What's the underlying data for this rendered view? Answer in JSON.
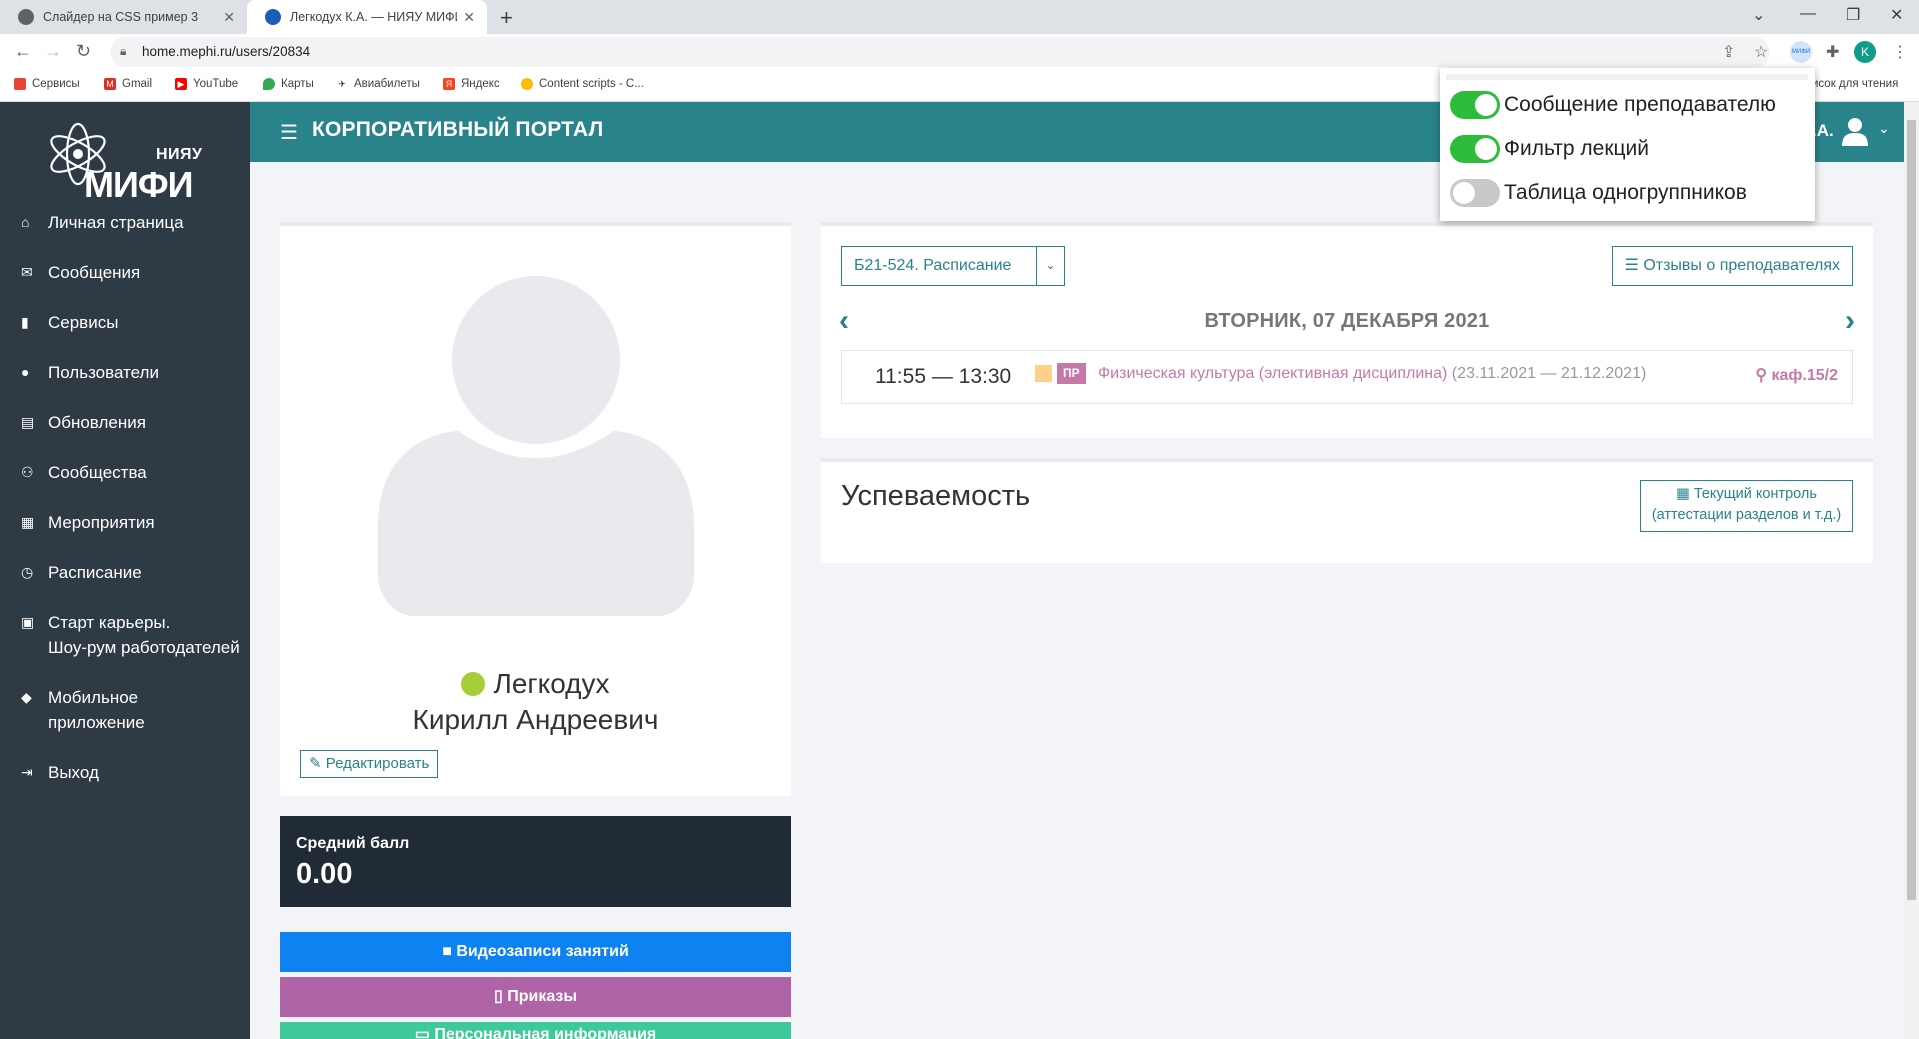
{
  "browser": {
    "tabs": [
      {
        "title": "Слайдер на CSS пример 3",
        "active": false
      },
      {
        "title": "Легкодух К.А. — НИЯУ МИФИ",
        "active": true
      }
    ],
    "url": "home.mephi.ru/users/20834",
    "bookmarks": [
      "Сервисы",
      "Gmail",
      "YouTube",
      "Карты",
      "Авиабилеты",
      "Яндекс",
      "Content scripts - C..."
    ],
    "reading_list": "исок для чтения",
    "profile_initial": "K"
  },
  "sidebar": {
    "logo": {
      "top": "НИЯУ",
      "main": "МИФИ"
    },
    "items": [
      {
        "icon": "home-icon",
        "label": "Личная страница"
      },
      {
        "icon": "envelope-icon",
        "label": "Сообщения"
      },
      {
        "icon": "bookmark-icon",
        "label": "Сервисы"
      },
      {
        "icon": "user-icon",
        "label": "Пользователи"
      },
      {
        "icon": "newspaper-icon",
        "label": "Обновления"
      },
      {
        "icon": "users-icon",
        "label": "Сообщества"
      },
      {
        "icon": "calendar-icon",
        "label": "Мероприятия"
      },
      {
        "icon": "clock-icon",
        "label": "Расписание"
      },
      {
        "icon": "briefcase-icon",
        "label": "Старт карьеры.\nШоу-рум работодателей"
      },
      {
        "icon": "android-icon",
        "label": "Мобильное\nприложение"
      },
      {
        "icon": "sign-out-icon",
        "label": "Выход"
      }
    ]
  },
  "header": {
    "title": "КОРПОРАТИВНЫЙ ПОРТАЛ",
    "user_short": ".А."
  },
  "profile": {
    "name_line1": "Легкодух",
    "name_line2": "Кирилл Андреевич",
    "edit_label": "Редактировать",
    "status_color": "#a6ce39"
  },
  "gpa": {
    "label": "Средний балл",
    "value": "0.00"
  },
  "buttons": {
    "video": "Видеозаписи занятий",
    "orders": "Приказы",
    "personal": "Персональная информация"
  },
  "schedule": {
    "group": "Б21-524. Расписание",
    "reviews": "Отзывы о преподавателях",
    "day": "ВТОРНИК, 07 ДЕКАБРЯ 2021",
    "lessons": [
      {
        "time": "11:55 — 13:30",
        "type": "ПР",
        "name": "Физическая культура (элективная дисциплина)",
        "dates": "(23.11.2021 — 21.12.2021)",
        "room": "каф.15/2"
      }
    ]
  },
  "performance": {
    "title": "Успеваемость",
    "control_line1": "Текущий контроль",
    "control_line2": "(аттестации разделов и т.д.)"
  },
  "popup": {
    "toggles": [
      {
        "label": "Сообщение преподавателю",
        "on": true
      },
      {
        "label": "Фильтр лекций",
        "on": true
      },
      {
        "label": "Таблица одногруппников",
        "on": false
      }
    ]
  },
  "colors": {
    "accent": "#29838a",
    "sidebar": "#2f3b44",
    "lesson": "#c679a8",
    "video_btn": "#0d82f0",
    "orders_btn": "#b064a8",
    "personal_btn": "#3ec99a",
    "toggle_on": "#2ebd3b"
  }
}
